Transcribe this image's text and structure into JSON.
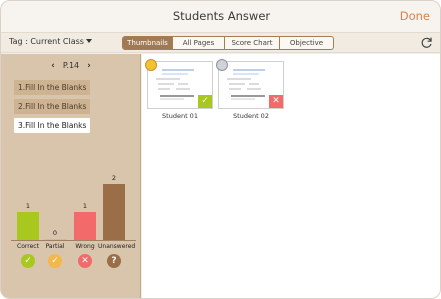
{
  "header": {
    "title": "Students Answer",
    "done_label": "Done"
  },
  "toolbar": {
    "tag_label": "Tag : Current Class",
    "tabs": [
      "Thumbnails",
      "All Pages",
      "Score Chart",
      "Objective"
    ],
    "active_tab": "Thumbnails"
  },
  "sidebar": {
    "page": "P.14",
    "questions": [
      "1.Fill In the Blanks",
      "2.Fill In the Blanks",
      "3.Fill In the Blanks"
    ],
    "selected_question": 2
  },
  "chart_data": {
    "type": "bar",
    "categories": [
      "Correct",
      "Partial",
      "Wrong",
      "Unanswered"
    ],
    "values": [
      1,
      0,
      1,
      2
    ],
    "colors": [
      "#a8c81e",
      "#f2b84a",
      "#f26a6a",
      "#9a6e46"
    ]
  },
  "students": [
    {
      "name": "Student 01",
      "result": "correct",
      "medal": "gold"
    },
    {
      "name": "Student 02",
      "result": "wrong",
      "medal": "silver"
    }
  ],
  "colors": {
    "accent": "#d9824a",
    "correct": "#a8c81e",
    "wrong": "#f26a6a",
    "partial": "#f2b84a",
    "unanswered": "#9a6e46"
  },
  "icons": {
    "refresh": "refresh-icon",
    "prev": "chevron-left-icon",
    "next": "chevron-right-icon"
  }
}
